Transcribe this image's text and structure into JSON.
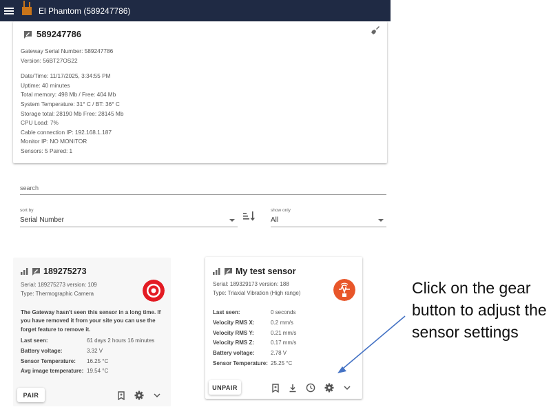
{
  "header": {
    "app_title": "El Phantom (589247786)"
  },
  "gateway": {
    "title": "589247786",
    "serial_line": "Gateway Serial Number: 589247786",
    "version_line": "Version: 56BT27OS22",
    "details": [
      "Date/Time: 11/17/2025, 3:34:55 PM",
      "Uptime: 40 minutes",
      "Total memory: 498 Mb / Free: 404 Mb",
      "System Temperature: 31° C / BT: 36° C",
      "Storage total: 28190 Mb Free: 28145 Mb",
      "CPU Load: 7%",
      "Cable connection IP: 192.168.1.187",
      "Monitor IP: NO MONITOR",
      "Sensors: 5 Paired: 1"
    ]
  },
  "search": {
    "placeholder": "search"
  },
  "sort": {
    "label": "sort by",
    "value": "Serial Number"
  },
  "show": {
    "label": "show only",
    "value": "All"
  },
  "sensors": [
    {
      "name": "189275273",
      "serial_line": "Serial: 189275273 version: 109",
      "type_line": "Type: Thermographic Camera",
      "warning": "The Gateway hasn't seen this sensor in a long time. If you have removed it from your site you can use the forget feature to remove it.",
      "fields": [
        {
          "label": "Last seen:",
          "value": "61 days 2 hours 16 minutes"
        },
        {
          "label": "Battery voltage:",
          "value": "3.32 V"
        },
        {
          "label": "Sensor Temperature:",
          "value": "16.25 °C"
        },
        {
          "label": "Avg image temperature:",
          "value": "19.54 °C"
        }
      ],
      "button": "PAIR"
    },
    {
      "name": "My test sensor",
      "serial_line": "Serial: 189329173 version: 188",
      "type_line": "Type: Triaxial Vibration (High range)",
      "fields": [
        {
          "label": "Last seen:",
          "value": "0 seconds"
        },
        {
          "label": "Velocity RMS X:",
          "value": "0.2 mm/s"
        },
        {
          "label": "Velocity RMS Y:",
          "value": "0.21 mm/s"
        },
        {
          "label": "Velocity RMS Z:",
          "value": "0.17 mm/s"
        },
        {
          "label": "Battery voltage:",
          "value": "2.78 V"
        },
        {
          "label": "Sensor Temperature:",
          "value": "25.25 °C"
        }
      ],
      "button": "UNPAIR"
    }
  ],
  "annotation": {
    "text": "Click on the gear button to adjust the sensor settings"
  },
  "colors": {
    "topbar": "#1f2a44",
    "thermal_icon": "#e31b23",
    "vibration_icon": "#e8562a",
    "annotation_arrow": "#4472c4"
  }
}
